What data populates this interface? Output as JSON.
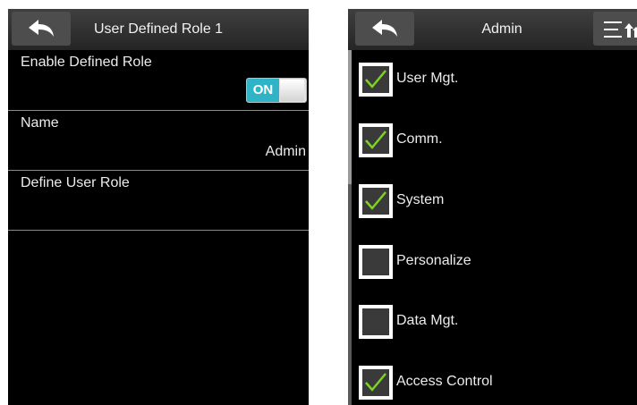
{
  "left_screen": {
    "title": "User Defined Role 1",
    "rows": [
      {
        "label": "Enable Defined Role",
        "toggle": "ON",
        "enabled": true
      },
      {
        "label": "Name",
        "value": "Admin"
      },
      {
        "label": "Define User Role"
      }
    ]
  },
  "right_screen": {
    "title": "Admin",
    "items": [
      {
        "label": "User Mgt.",
        "checked": true
      },
      {
        "label": "Comm.",
        "checked": true
      },
      {
        "label": "System",
        "checked": true
      },
      {
        "label": "Personalize",
        "checked": false
      },
      {
        "label": "Data Mgt.",
        "checked": false
      },
      {
        "label": "Access Control",
        "checked": true
      }
    ]
  },
  "colors": {
    "toggle_on": "#2fb3c6",
    "checkmark": "#7ed321",
    "background": "#000000",
    "titlebar": "#2e2e2e"
  },
  "icons": {
    "back": "back-arrow-icon",
    "menu": "sort-menu-icon",
    "check": "checkmark-icon"
  }
}
